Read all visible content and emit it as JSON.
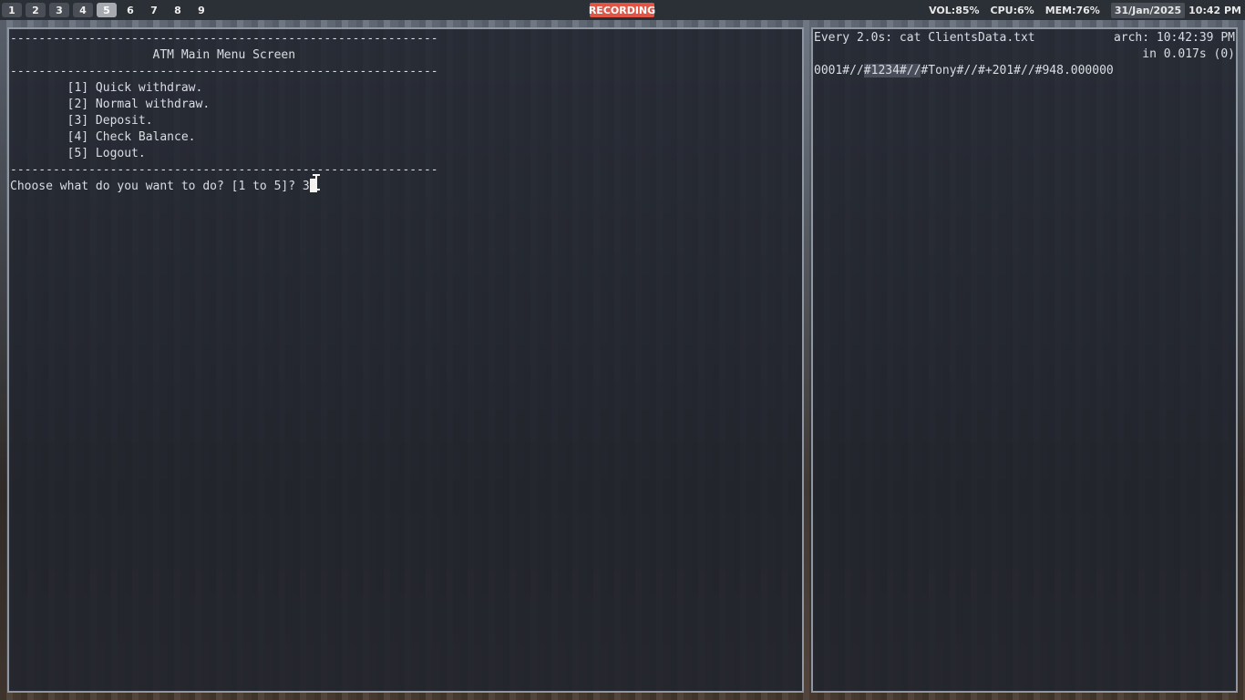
{
  "topbar": {
    "workspaces": [
      "1",
      "2",
      "3",
      "4",
      "5",
      "6",
      "7",
      "8",
      "9"
    ],
    "active_workspace": "5",
    "recording_label": "RECORDING",
    "vol": "VOL:85%",
    "cpu": "CPU:6%",
    "mem": "MEM:76%",
    "date": "31/Jan/2025",
    "time": "10:42 PM"
  },
  "atm": {
    "separator": "------------------------------------------------------------",
    "title": "                    ATM Main Menu Screen",
    "options": [
      "        [1] Quick withdraw.",
      "        [2] Normal withdraw.",
      "        [3] Deposit.",
      "        [4] Check Balance.",
      "        [5] Logout."
    ],
    "prompt": "Choose what do you want to do? [1 to 5]? ",
    "input_value": "3"
  },
  "watch": {
    "command": "Every 2.0s: cat ClientsData.txt",
    "host_time": "arch: 10:42:39 PM",
    "duration": "in 0.017s (0)",
    "record_prefix": "0001#//",
    "record_highlight": "#1234#//",
    "record_suffix": "#Tony#//#+201#//#948.000000"
  }
}
